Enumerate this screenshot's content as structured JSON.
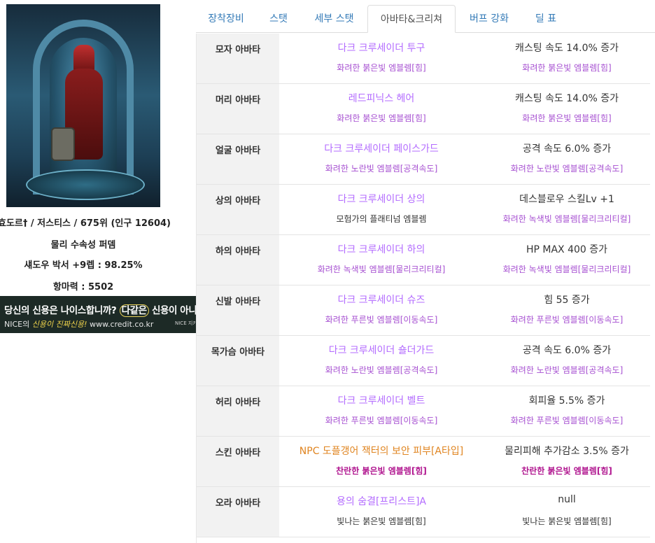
{
  "profile": {
    "line1": "효도르† / 저스티스 / 675위 (인구 12604)",
    "line2": "물리 수속성 퍼뎀",
    "line3": "섀도우 박서 +9렙 : 98.25%",
    "line4": "항마력 : 5502"
  },
  "banner": {
    "main_pre": "당신의 신용은 나이스합니까? ",
    "main_em": "다같은",
    "main_post": " 신용이 아니다!",
    "info": "i",
    "sub_pre": "NICE의 ",
    "sub_hl": "신용이 진짜신용!",
    "sub_url": " www.credit.co.kr",
    "logo": "NICE 지키미"
  },
  "tabs": [
    {
      "label": "장착장비"
    },
    {
      "label": "스탯"
    },
    {
      "label": "세부 스탯"
    },
    {
      "label": "아바타&크리쳐"
    },
    {
      "label": "버프 강화"
    },
    {
      "label": "딜 표"
    }
  ],
  "active_tab": "아바타&크리쳐",
  "colors": {
    "rare_item": "#b36bff",
    "unique_item": "#e08521",
    "emblem": "#a64fd1",
    "brilliant_emblem": "#b0158f",
    "slot_bg": "#f2f2f2",
    "tab_link": "#337ab7"
  },
  "rows": [
    {
      "slot": "모자 아바타",
      "item": "다크 크루세이더 투구",
      "item_emblem": "화려한 붉은빛 엠블렘[힘]",
      "effect": "캐스팅 속도 14.0% 증가",
      "effect_emblem": "화려한 붉은빛 엠블렘[힘]"
    },
    {
      "slot": "머리 아바타",
      "item": "레드피닉스 헤어",
      "item_emblem": "화려한 붉은빛 엠블렘[힘]",
      "effect": "캐스팅 속도 14.0% 증가",
      "effect_emblem": "화려한 붉은빛 엠블렘[힘]"
    },
    {
      "slot": "얼굴 아바타",
      "item": "다크 크루세이더 페이스가드",
      "item_emblem": "화려한 노란빛 엠블렘[공격속도]",
      "effect": "공격 속도 6.0% 증가",
      "effect_emblem": "화려한 노란빛 엠블렘[공격속도]"
    },
    {
      "slot": "상의 아바타",
      "item": "다크 크루세이더 상의",
      "item_emblem": "모험가의 플래티넘 엠블렘",
      "effect": "데스블로우 스킬Lv +1",
      "effect_emblem": "화려한 녹색빛 엠블렘[물리크리티컬]"
    },
    {
      "slot": "하의 아바타",
      "item": "다크 크루세이더 하의",
      "item_emblem": "화려한 녹색빛 엠블렘[물리크리티컬]",
      "effect": "HP MAX 400 증가",
      "effect_emblem": "화려한 녹색빛 엠블렘[물리크리티컬]"
    },
    {
      "slot": "신발 아바타",
      "item": "다크 크루세이더 슈즈",
      "item_emblem": "화려한 푸른빛 엠블렘[이동속도]",
      "effect": "힘 55 증가",
      "effect_emblem": "화려한 푸른빛 엠블렘[이동속도]"
    },
    {
      "slot": "목가슴 아바타",
      "item": "다크 크루세이더 숄더가드",
      "item_emblem": "화려한 노란빛 엠블렘[공격속도]",
      "effect": "공격 속도 6.0% 증가",
      "effect_emblem": "화려한 노란빛 엠블렘[공격속도]"
    },
    {
      "slot": "허리 아바타",
      "item": "다크 크루세이더 벨트",
      "item_emblem": "화려한 푸른빛 엠블렘[이동속도]",
      "effect": "회피율 5.5% 증가",
      "effect_emblem": "화려한 푸른빛 엠블렘[이동속도]"
    },
    {
      "slot": "스킨 아바타",
      "item": "NPC 도플갱어 잭터의 보안 피부[A타입]",
      "item_emblem": "찬란한 붉은빛 엠블렘[힘]",
      "effect": "물리피해 추가감소 3.5% 증가",
      "effect_emblem": "찬란한 붉은빛 엠블렘[힘]"
    },
    {
      "slot": "오라 아바타",
      "item": "용의 숨결[프리스트]A",
      "item_emblem": "빛나는 붉은빛 엠블렘[힘]",
      "effect": "null",
      "effect_emblem": "빛나는 붉은빛 엠블렘[힘]"
    }
  ]
}
